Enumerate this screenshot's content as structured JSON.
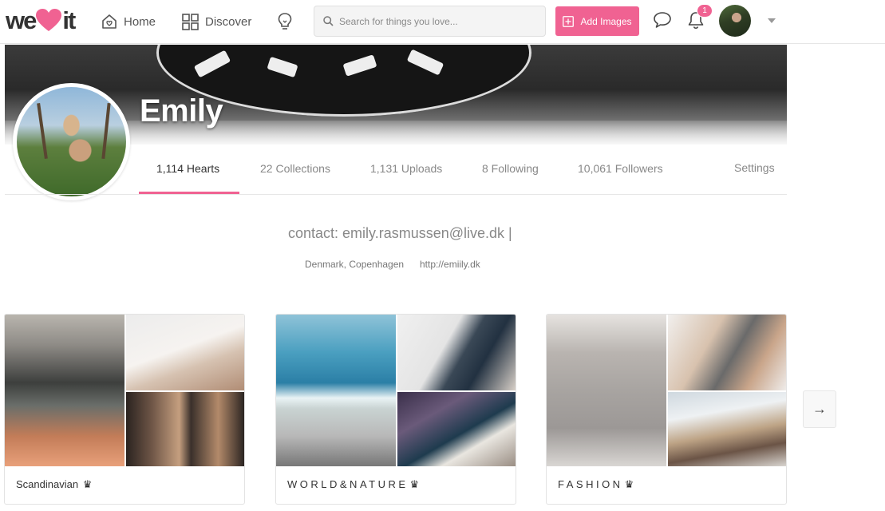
{
  "nav": {
    "logo_left": "we",
    "logo_right": "it",
    "home_label": "Home",
    "discover_label": "Discover",
    "search_placeholder": "Search for things you love...",
    "add_images_label": "Add Images",
    "notification_count": "1",
    "accent_color": "#f06292"
  },
  "profile": {
    "name": "Emily",
    "tabs": [
      {
        "label": "1,114 Hearts",
        "active": true
      },
      {
        "label": "22 Collections",
        "active": false
      },
      {
        "label": "1,131 Uploads",
        "active": false
      },
      {
        "label": "8 Following",
        "active": false
      },
      {
        "label": "10,061 Followers",
        "active": false
      }
    ],
    "settings_label": "Settings",
    "contact": "contact: emily.rasmussen@live.dk |",
    "location": "Denmark, Copenhagen",
    "website": "http://emiily.dk"
  },
  "collections": [
    {
      "title": "Scandinavian",
      "crown": "♛"
    },
    {
      "title": "WORLD&NATURE",
      "crown": "♛"
    },
    {
      "title": "FASHION",
      "crown": "♛"
    }
  ],
  "next_arrow": "→"
}
